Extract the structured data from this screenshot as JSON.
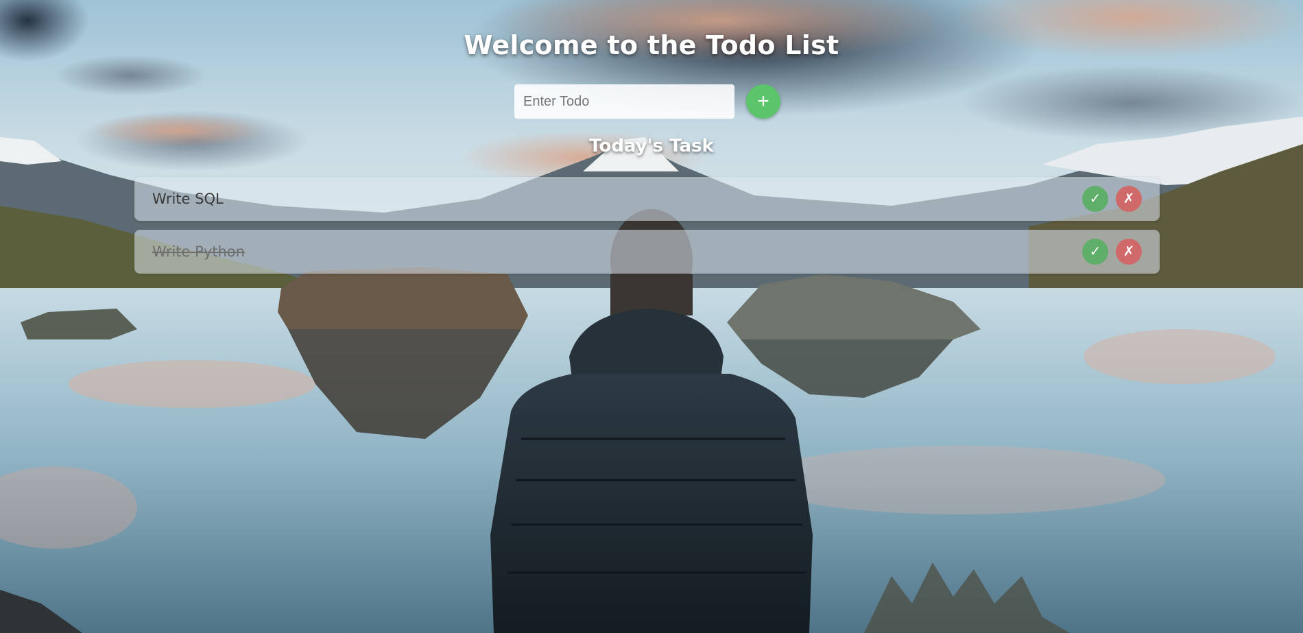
{
  "header": {
    "title": "Welcome to the Todo List"
  },
  "form": {
    "input_placeholder": "Enter Todo",
    "input_value": "",
    "add_button_label": "+"
  },
  "tasks_section": {
    "title": "Today's Task",
    "items": [
      {
        "text": "Write SQL",
        "completed": false,
        "complete_label": "✓",
        "delete_label": "✗"
      },
      {
        "text": "Write Python",
        "completed": true,
        "complete_label": "✓",
        "delete_label": "✗"
      }
    ]
  },
  "colors": {
    "add_button": "#5cc46b",
    "complete_button": "#5fae6a",
    "delete_button": "#d06a6a"
  },
  "icons": {
    "add": "plus-icon",
    "complete": "check-icon",
    "delete": "cross-icon"
  }
}
